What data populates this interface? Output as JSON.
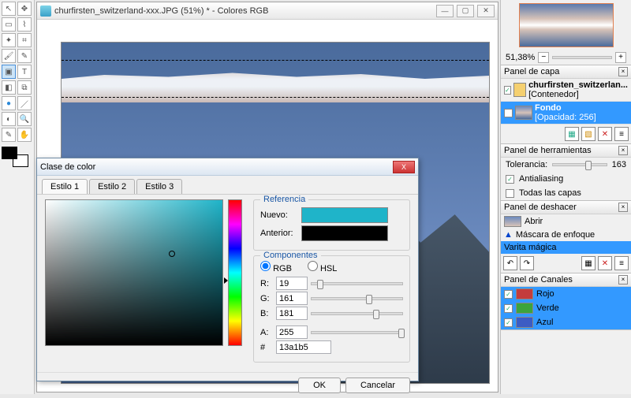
{
  "window": {
    "title": "churfirsten_switzerland-xxx.JPG (51%) * - Colores RGB"
  },
  "dialog": {
    "title": "Clase de color",
    "tabs": [
      "Estilo 1",
      "Estilo 2",
      "Estilo 3"
    ],
    "reference": {
      "legend": "Referencia",
      "new_label": "Nuevo:",
      "old_label": "Anterior:",
      "new_color": "#1FB4C9",
      "old_color": "#000000"
    },
    "components": {
      "legend": "Componentes",
      "rgb_label": "RGB",
      "hsl_label": "HSL",
      "mode": "RGB",
      "r_label": "R:",
      "r": "19",
      "g_label": "G:",
      "g": "161",
      "b_label": "B:",
      "b": "181",
      "a_label": "A:",
      "a": "255",
      "hex_label": "#",
      "hex": "13a1b5"
    },
    "ok": "OK",
    "cancel": "Cancelar"
  },
  "zoom": {
    "value": "51,38%"
  },
  "layers": {
    "title": "Panel de capa",
    "items": [
      {
        "name": "churfirsten_switzerlan...",
        "sub": "[Contenedor]",
        "selected": false
      },
      {
        "name": "Fondo",
        "sub": "[Opacidad: 256]",
        "selected": true
      }
    ]
  },
  "tools_panel": {
    "title": "Panel de herramientas",
    "tolerance_label": "Tolerancia:",
    "tolerance_value": "163",
    "antialias_label": "Antialiasing",
    "all_layers_label": "Todas las capas"
  },
  "undo": {
    "title": "Panel de deshacer",
    "items": [
      "Abrir",
      "Máscara de enfoque",
      "Varita mágica"
    ]
  },
  "channels": {
    "title": "Panel de Canales",
    "items": [
      {
        "label": "Rojo",
        "color": "#c43c3c"
      },
      {
        "label": "Verde",
        "color": "#3ca43c"
      },
      {
        "label": "Azul",
        "color": "#3c5cc4"
      }
    ]
  }
}
